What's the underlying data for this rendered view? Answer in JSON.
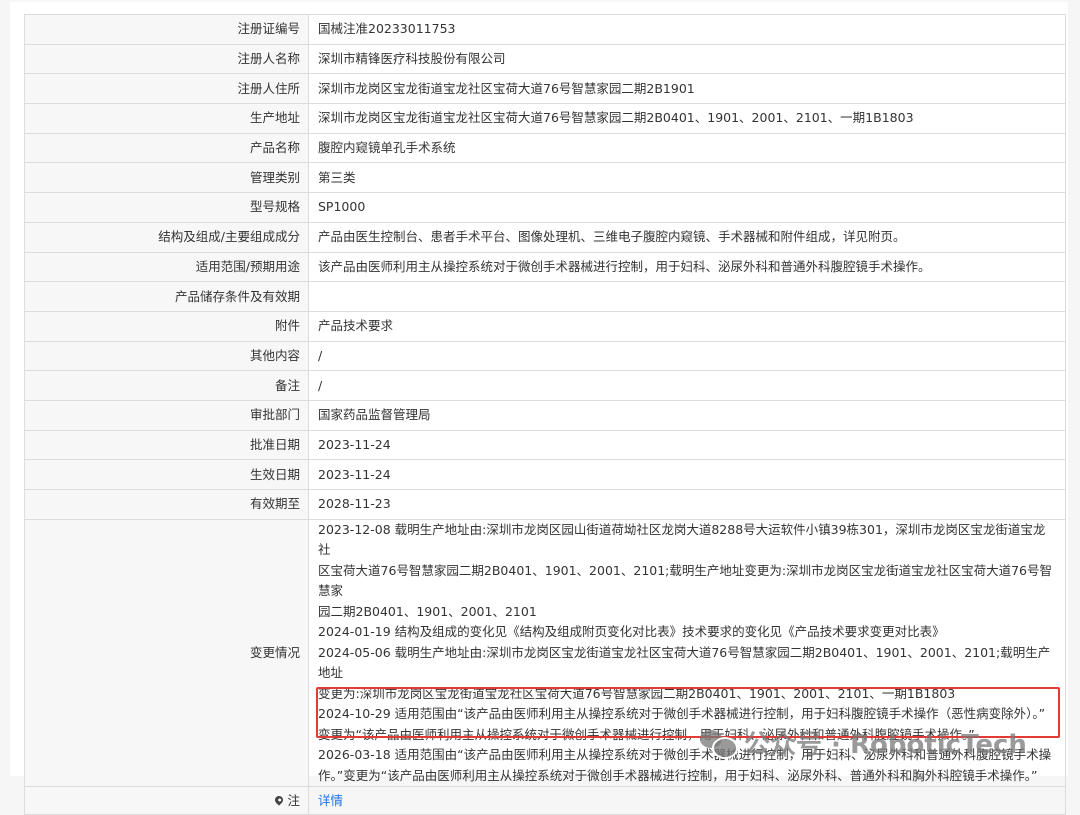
{
  "rows": [
    {
      "label": "注册证编号",
      "value": "国械注准20233011753"
    },
    {
      "label": "注册人名称",
      "value": "深圳市精锋医疗科技股份有限公司"
    },
    {
      "label": "注册人住所",
      "value": "深圳市龙岗区宝龙街道宝龙社区宝荷大道76号智慧家园二期2B1901"
    },
    {
      "label": "生产地址",
      "value": "深圳市龙岗区宝龙街道宝龙社区宝荷大道76号智慧家园二期2B0401、1901、2001、2101、一期1B1803"
    },
    {
      "label": "产品名称",
      "value": "腹腔内窥镜单孔手术系统"
    },
    {
      "label": "管理类别",
      "value": "第三类"
    },
    {
      "label": "型号规格",
      "value": "SP1000"
    },
    {
      "label": "结构及组成/主要组成成分",
      "value": "产品由医生控制台、患者手术平台、图像处理机、三维电子腹腔内窥镜、手术器械和附件组成，详见附页。"
    },
    {
      "label": "适用范围/预期用途",
      "value": "该产品由医师利用主从操控系统对于微创手术器械进行控制，用于妇科、泌尿外科和普通外科腹腔镜手术操作。"
    },
    {
      "label": "产品储存条件及有效期",
      "value": ""
    },
    {
      "label": "附件",
      "value": "产品技术要求"
    },
    {
      "label": "其他内容",
      "value": "/"
    },
    {
      "label": "备注",
      "value": "/"
    },
    {
      "label": "审批部门",
      "value": "国家药品监督管理局"
    },
    {
      "label": "批准日期",
      "value": "2023-11-24"
    },
    {
      "label": "生效日期",
      "value": "2023-11-24"
    },
    {
      "label": "有效期至",
      "value": "2028-11-23"
    }
  ],
  "changes": {
    "label": "变更情况",
    "lines": [
      "2023-12-08 载明生产地址由:深圳市龙岗区园山街道荷坳社区龙岗大道8288号大运软件小镇39栋301，深圳市龙岗区宝龙街道宝龙社",
      "区宝荷大道76号智慧家园二期2B0401、1901、2001、2101;载明生产地址变更为:深圳市龙岗区宝龙街道宝龙社区宝荷大道76号智慧家",
      "园二期2B0401、1901、2001、2101",
      "2024-01-19 结构及组成的变化见《结构及组成附页变化对比表》技术要求的变化见《产品技术要求变更对比表》",
      "2024-05-06 载明生产地址由:深圳市龙岗区宝龙街道宝龙社区宝荷大道76号智慧家园二期2B0401、1901、2001、2101;载明生产地址",
      "变更为:深圳市龙岗区宝龙街道宝龙社区宝荷大道76号智慧家园二期2B0401、1901、2001、2101、一期1B1803",
      "2024-10-29 适用范围由“该产品由医师利用主从操控系统对于微创手术器械进行控制，用于妇科腹腔镜手术操作（恶性病变除外）。”",
      "变更为“该产品由医师利用主从操控系统对于微创手术器械进行控制，用于妇科、泌尿外科和普通外科腹腔镜手术操作。”",
      "2026-03-18 适用范围由“该产品由医师利用主从操控系统对于微创手术器械进行控制，用于妇科、泌尿外科和普通外科腹腔镜手术操",
      "作。”变更为“该产品由医师利用主从操控系统对于微创手术器械进行控制，用于妇科、泌尿外科、普通外科和胸外科腔镜手术操作。”"
    ]
  },
  "note": {
    "label": "注",
    "link": "详情"
  },
  "watermark": {
    "text": "公众号 · RoboticTech"
  },
  "colors": {
    "highlight": "#e53935",
    "link": "#1a73e8"
  }
}
